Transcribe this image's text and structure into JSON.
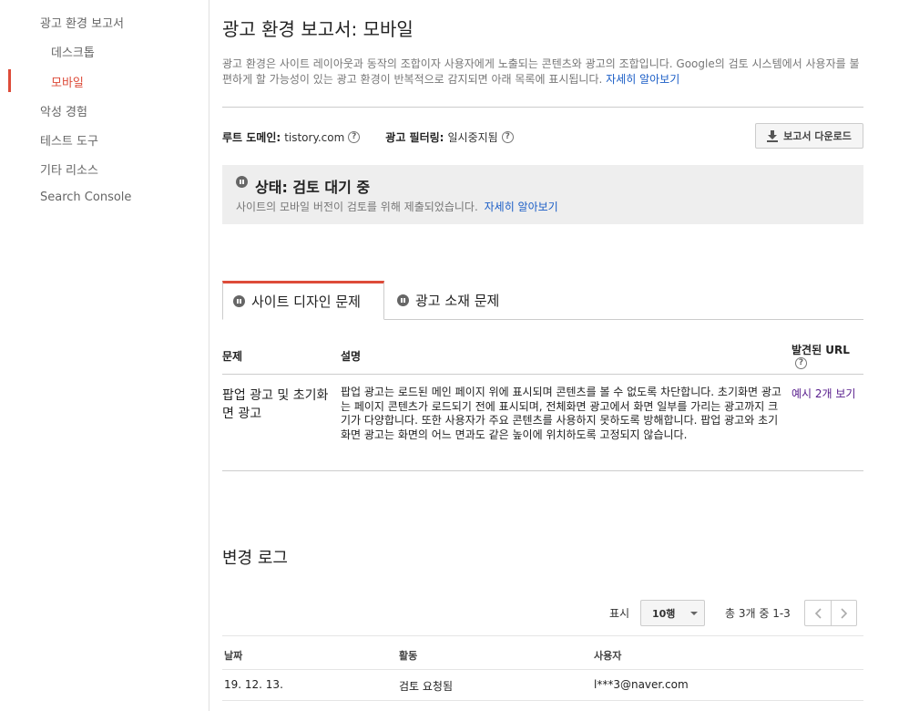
{
  "sidebar": {
    "items": [
      {
        "label": "광고 환경 보고서"
      },
      {
        "label": "데스크톱"
      },
      {
        "label": "모바일"
      },
      {
        "label": "악성 경험"
      },
      {
        "label": "테스트 도구"
      },
      {
        "label": "기타 리소스"
      },
      {
        "label": "Search Console"
      }
    ]
  },
  "page": {
    "title": "광고 환경 보고서: 모바일",
    "intro": "광고 환경은 사이트 레이아웃과 동작의 조합이자 사용자에게 노출되는 콘텐츠와 광고의 조합입니다. Google의 검토 시스템에서 사용자를 불편하게 할 가능성이 있는 광고 환경이 반복적으로 감지되면 아래 목록에 표시됩니다.",
    "intro_link": "자세히 알아보기"
  },
  "meta": {
    "root_domain_label": "루트 도메인:",
    "root_domain_value": "tistory.com",
    "filtering_label": "광고 필터링:",
    "filtering_value": "일시중지됨",
    "help_glyph": "?",
    "download_label": "보고서 다운로드"
  },
  "status": {
    "title": "상태: 검토 대기 중",
    "desc": "사이트의 모바일 버전이 검토를 위해 제출되었습니다.",
    "link": "자세히 알아보기"
  },
  "tabs": [
    {
      "label": "사이트 디자인 문제",
      "active": true
    },
    {
      "label": "광고 소재 문제",
      "active": false
    }
  ],
  "issues": {
    "headers": {
      "problem": "문제",
      "desc": "설명",
      "url": "발견된 URL"
    },
    "rows": [
      {
        "problem": "팝업 광고 및 초기화면 광고",
        "desc": "팝업 광고는 로드된 메인 페이지 위에 표시되며 콘텐츠를 볼 수 없도록 차단합니다. 초기화면 광고는 페이지 콘텐츠가 로드되기 전에 표시되며, 전체화면 광고에서 화면 일부를 가리는 광고까지 크기가 다양합니다. 또한 사용자가 주요 콘텐츠를 사용하지 못하도록 방해합니다. 팝업 광고와 초기화면 광고는 화면의 어느 면과도 같은 높이에 위치하도록 고정되지 않습니다.",
        "link": "예시 2개 보기"
      }
    ]
  },
  "changelog": {
    "title": "변경 로그",
    "show_label": "표시",
    "rows_value": "10행",
    "range_text": "총 3개 중 1-3",
    "headers": {
      "date": "날짜",
      "activity": "활동",
      "user": "사용자"
    },
    "rows": [
      {
        "date": "19. 12. 13.",
        "activity": "검토 요청됨",
        "user": "l***3@naver.com"
      }
    ]
  },
  "colors": {
    "accent": "#dd4b39",
    "link": "#1a5dc6",
    "visited_link": "#551a8b",
    "status_bg": "#eeeeee"
  }
}
